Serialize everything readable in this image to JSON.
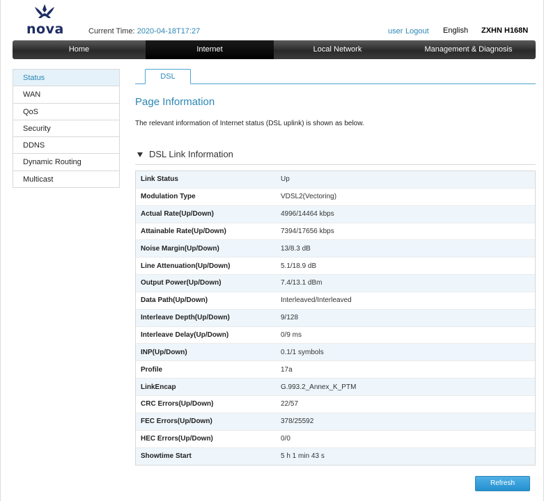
{
  "header": {
    "logo_text": "nova",
    "current_time_label": "Current Time:",
    "current_time_value": "2020-04-18T17:27",
    "user": "user",
    "logout": "Logout",
    "language": "English",
    "model": "ZXHN H168N"
  },
  "mainnav": [
    {
      "label": "Home"
    },
    {
      "label": "Internet"
    },
    {
      "label": "Local Network"
    },
    {
      "label": "Management & Diagnosis"
    }
  ],
  "sidebar": {
    "items": [
      {
        "label": "Status"
      },
      {
        "label": "WAN"
      },
      {
        "label": "QoS"
      },
      {
        "label": "Security"
      },
      {
        "label": "DDNS"
      },
      {
        "label": "Dynamic Routing"
      },
      {
        "label": "Multicast"
      }
    ]
  },
  "tab": {
    "label": "DSL"
  },
  "page": {
    "title": "Page Information",
    "description": "The relevant information of Internet status (DSL uplink) is shown as below."
  },
  "section": {
    "title": "DSL Link Information"
  },
  "table": {
    "rows": [
      {
        "label": "Link Status",
        "value": "Up"
      },
      {
        "label": "Modulation Type",
        "value": "VDSL2(Vectoring)"
      },
      {
        "label": "Actual Rate(Up/Down)",
        "value": "4996/14464 kbps"
      },
      {
        "label": "Attainable Rate(Up/Down)",
        "value": "7394/17656 kbps"
      },
      {
        "label": "Noise Margin(Up/Down)",
        "value": "13/8.3 dB"
      },
      {
        "label": "Line Attenuation(Up/Down)",
        "value": "5.1/18.9 dB"
      },
      {
        "label": "Output Power(Up/Down)",
        "value": "7.4/13.1 dBm"
      },
      {
        "label": "Data Path(Up/Down)",
        "value": "Interleaved/Interleaved"
      },
      {
        "label": "Interleave Depth(Up/Down)",
        "value": "9/128"
      },
      {
        "label": "Interleave Delay(Up/Down)",
        "value": "0/9 ms"
      },
      {
        "label": "INP(Up/Down)",
        "value": "0.1/1 symbols"
      },
      {
        "label": "Profile",
        "value": "17a"
      },
      {
        "label": "LinkEncap",
        "value": "G.993.2_Annex_K_PTM"
      },
      {
        "label": "CRC Errors(Up/Down)",
        "value": "22/57"
      },
      {
        "label": "FEC Errors(Up/Down)",
        "value": "378/25592"
      },
      {
        "label": "HEC Errors(Up/Down)",
        "value": "0/0"
      },
      {
        "label": "Showtime Start",
        "value": "5 h 1 min 43 s"
      }
    ]
  },
  "buttons": {
    "refresh": "Refresh"
  },
  "colors": {
    "accent": "#2b86b5",
    "nav_dark": "#2a2a2a",
    "row_alt": "#eef6fc",
    "logo": "#1d2c64"
  }
}
